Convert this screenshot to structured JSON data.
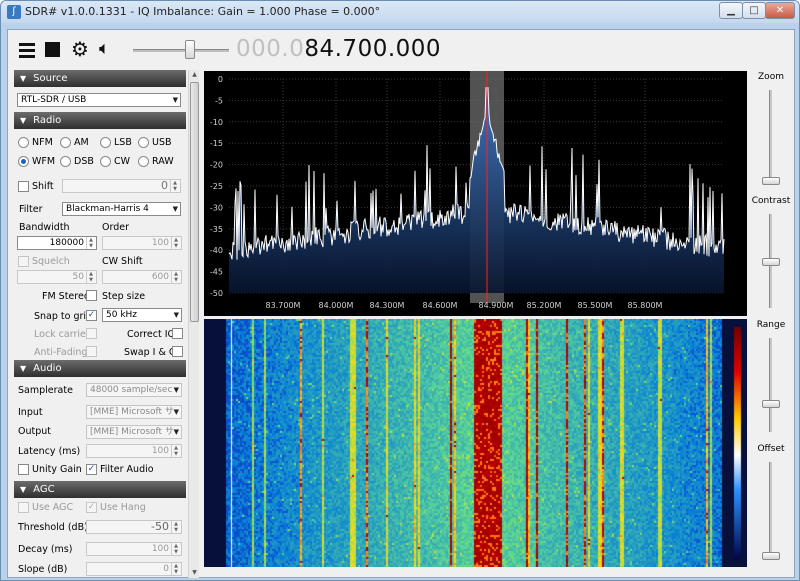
{
  "window": {
    "title": "SDR# v1.0.0.1331 - IQ Imbalance: Gain = 1.000 Phase = 0.000°",
    "minimize": "▁",
    "maximize": "□",
    "close": "✕"
  },
  "toolbar": {
    "menu_icon": "menu-icon",
    "stop_icon": "stop-icon",
    "gear_icon": "gear-icon",
    "speaker_icon": "speaker-icon",
    "frequency_dim": "000.0",
    "frequency_main": "84.700.000"
  },
  "source": {
    "header": "Source",
    "device": "RTL-SDR / USB"
  },
  "radio": {
    "header": "Radio",
    "modes": [
      "NFM",
      "AM",
      "LSB",
      "USB",
      "WFM",
      "DSB",
      "CW",
      "RAW"
    ],
    "selected_mode": "WFM",
    "shift_label": "Shift",
    "shift_value": "0",
    "filter_label": "Filter",
    "filter_value": "Blackman-Harris 4",
    "bandwidth_label": "Bandwidth",
    "bandwidth_value": "180000",
    "order_label": "Order",
    "order_value": "100",
    "squelch_label": "Squelch",
    "squelch_value": "50",
    "cw_shift_label": "CW Shift",
    "cw_shift_value": "600",
    "fm_stereo_label": "FM Stereo",
    "step_size_label": "Step size",
    "snap_label": "Snap to grid",
    "step_value": "50 kHz",
    "lock_carrier_label": "Lock carrier",
    "correct_iq_label": "Correct IQ",
    "anti_fading_label": "Anti-Fading",
    "swap_iq_label": "Swap I & Q"
  },
  "audio": {
    "header": "Audio",
    "samplerate_label": "Samplerate",
    "samplerate_value": "48000 sample/sec",
    "input_label": "Input",
    "input_value": "[MME] Microsoft サ",
    "output_label": "Output",
    "output_value": "[MME] Microsoft サ",
    "latency_label": "Latency (ms)",
    "latency_value": "100",
    "unity_gain_label": "Unity Gain",
    "filter_audio_label": "Filter Audio"
  },
  "agc": {
    "header": "AGC",
    "use_agc_label": "Use AGC",
    "use_hang_label": "Use Hang",
    "threshold_label": "Threshold (dB)",
    "threshold_value": "-50",
    "decay_label": "Decay (ms)",
    "decay_value": "100",
    "slope_label": "Slope (dB)",
    "slope_value": "0"
  },
  "right_panel": {
    "zoom": "Zoom",
    "contrast": "Contrast",
    "range": "Range",
    "offset": "Offset"
  },
  "spectrum": {
    "y_ticks": [
      "0",
      "-5",
      "-10",
      "-15",
      "-20",
      "-25",
      "-30",
      "-35",
      "-40",
      "-45",
      "-50"
    ],
    "x_ticks": [
      "83.700M",
      "84.000M",
      "84.300M",
      "84.600M",
      "84.900M",
      "85.200M",
      "85.500M",
      "85.800M"
    ],
    "center": "84.700M"
  },
  "colors": {
    "spectrum_fill": "#2f5fa0",
    "trace": "#ffffff",
    "center_line": "#ff2020",
    "band_highlight": "#7a7a7a"
  }
}
